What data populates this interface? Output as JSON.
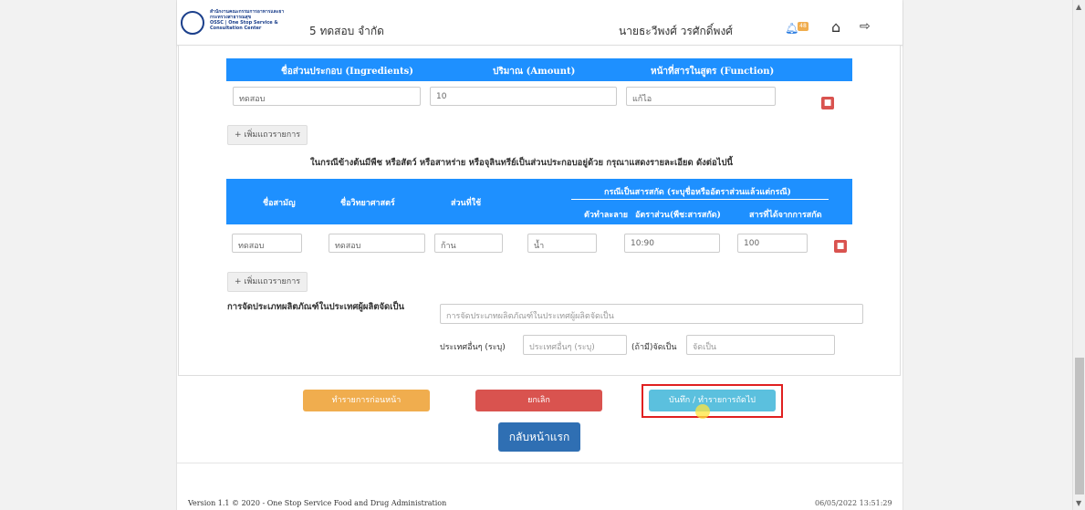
{
  "header": {
    "org_line1": "สำนักงานคณะกรรมการอาหารและยา",
    "org_line2": "กระทรวงสาธารณสุข",
    "org_line3": "OSSC | One Stop Service & Consultation Center",
    "company": "5 ทดสอบ จำกัด",
    "username": "นายธะวีพงศ์ วรศักดิ์พงศ์",
    "notification_count": "48"
  },
  "ingredients": {
    "headers": [
      "ชื่อส่วนประกอบ (Ingredients)",
      "ปริมาณ (Amount)",
      "หน้าที่สารในสูตร (Function)"
    ],
    "row": {
      "name": "ทดสอบ",
      "amount": "10",
      "function": "แก้ไอ"
    },
    "add_label": "+ เพิ่มแถวรายการ"
  },
  "note": "ในกรณีข้างต้นมีพืช หรือสัตว์ หรือสาหร่าย หรือจุลินทรีย์เป็นส่วนประกอบอยู่ด้วย กรุณาแสดงรายละเอียด ดังต่อไปนี้",
  "plants": {
    "headers": {
      "common_name": "ชื่อสามัญ",
      "scientific_name": "ชื่อวิทยาศาสตร์",
      "part_used": "ส่วนที่ใช้",
      "extract_group": "กรณีเป็นสารสกัด (ระบุชื่อหรืออัตราส่วนแล้วแต่กรณี)",
      "solvent": "ตัวทำละลาย",
      "ratio": "อัตราส่วน(พืช:สารสกัด)",
      "yield": "สารที่ได้จากการสกัด"
    },
    "row": {
      "common_name": "ทดสอบ",
      "scientific_name": "ทดสอบ",
      "part_used": "ก้าน",
      "solvent": "น้ำ",
      "ratio": "10:90",
      "yield": "100"
    },
    "add_label": "+ เพิ่มแถวรายการ"
  },
  "classification": {
    "label": "การจัดประเภทผลิตภัณฑ์ในประเทศผู้ผลิตจัดเป็น",
    "placeholder": "การจัดประเภทผลิตภัณฑ์ในประเทศผู้ผลิตจัดเป็น",
    "other_country_label": "ประเทศอื่นๆ (ระบุ)",
    "other_country_placeholder": "ประเทศอื่นๆ (ระบุ)",
    "other_class_label": "(ถ้ามี)จัดเป็น",
    "other_class_placeholder": "จัดเป็น"
  },
  "actions": {
    "prev_label": "ทำรายการก่อนหน้า",
    "cancel_label": "ยกเลิก",
    "save_next_label": "บันทึก / ทำรายการถัดไป",
    "home_label": "กลับหน้าแรก"
  },
  "footer": {
    "version": "Version 1.1 © 2020 - One Stop Service Food and Drug Administration",
    "timestamp": "06/05/2022 13:51:29"
  },
  "colors": {
    "table_header": "#1e90ff",
    "prev_button": "#f0ad4e",
    "cancel_button": "#d9534f",
    "save_button": "#5bc0de",
    "home_button": "#2f6fb3",
    "highlight": "#e02020"
  }
}
